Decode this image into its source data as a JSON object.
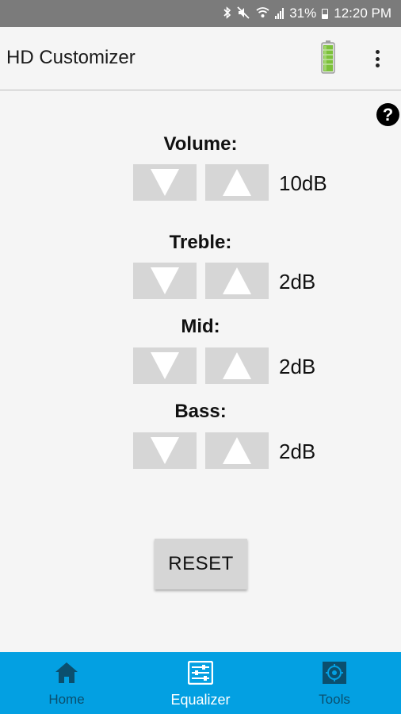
{
  "status_bar": {
    "battery_percent": "31%",
    "time": "12:20 PM",
    "icons": [
      "bluetooth-icon",
      "mute-icon",
      "wifi-icon",
      "signal-icon",
      "battery-icon"
    ]
  },
  "app_bar": {
    "title": "HD Customizer",
    "battery_icon": "battery-full-icon",
    "menu_icon": "more-vert-icon"
  },
  "help": {
    "glyph": "?"
  },
  "equalizer": {
    "rows": [
      {
        "label": "Volume:",
        "value": "10dB"
      },
      {
        "label": "Treble:",
        "value": "2dB"
      },
      {
        "label": "Mid:",
        "value": "2dB"
      },
      {
        "label": "Bass:",
        "value": "2dB"
      }
    ],
    "reset_label": "RESET"
  },
  "bottom_nav": {
    "items": [
      {
        "label": "Home",
        "icon": "home-icon",
        "active": false
      },
      {
        "label": "Equalizer",
        "icon": "equalizer-icon",
        "active": true
      },
      {
        "label": "Tools",
        "icon": "tools-icon",
        "active": false
      }
    ]
  },
  "colors": {
    "nav_bg": "#03a0e2",
    "nav_active": "#ffffff",
    "nav_inactive": "#0b4f6e",
    "button_bg": "#d6d6d6",
    "status_bar_bg": "#7b7b7b"
  }
}
